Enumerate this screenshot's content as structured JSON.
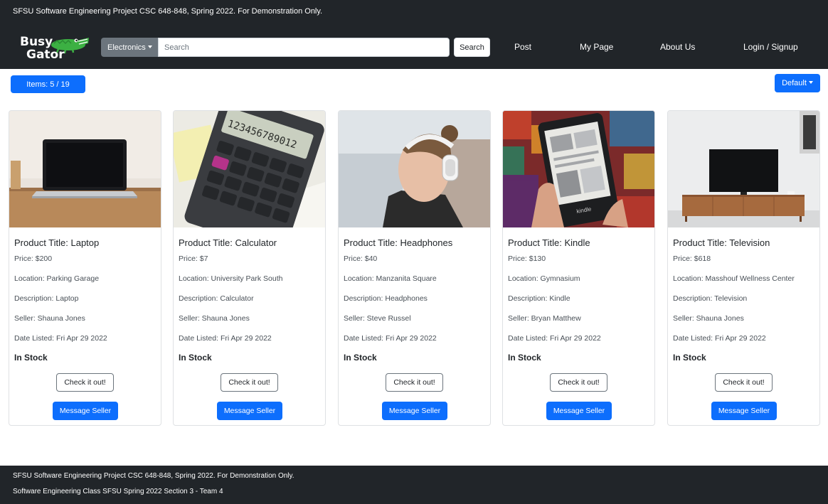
{
  "banner": {
    "text": "SFSU Software Engineering Project CSC 648-848, Spring 2022. For Demonstration Only."
  },
  "brand": {
    "line1": "Busy",
    "line2": "Gator"
  },
  "search": {
    "category": "Electronics",
    "placeholder": "Search",
    "button_label": "Search"
  },
  "nav": [
    "Post",
    "My Page",
    "About Us",
    "Login / Signup"
  ],
  "toolbar": {
    "items_label": "Items: 5 / 19",
    "sort_label": "Default"
  },
  "products": [
    {
      "title": "Product Title: Laptop",
      "price": "Price: $200",
      "location": "Location: Parking Garage",
      "description": "Description: Laptop",
      "seller": "Seller: Shauna Jones",
      "date": "Date Listed: Fri Apr 29 2022",
      "stock": "In Stock",
      "check": "Check it out!",
      "message": "Message Seller"
    },
    {
      "title": "Product Title: Calculator",
      "price": "Price: $7",
      "location": "Location: University Park South",
      "description": "Description: Calculator",
      "seller": "Seller: Shauna Jones",
      "date": "Date Listed: Fri Apr 29 2022",
      "stock": "In Stock",
      "check": "Check it out!",
      "message": "Message Seller",
      "image_text": "123456789012"
    },
    {
      "title": "Product Title: Headphones",
      "price": "Price: $40",
      "location": "Location: Manzanita Square",
      "description": "Description: Headphones",
      "seller": "Seller: Steve Russel",
      "date": "Date Listed: Fri Apr 29 2022",
      "stock": "In Stock",
      "check": "Check it out!",
      "message": "Message Seller"
    },
    {
      "title": "Product Title: Kindle",
      "price": "Price: $130",
      "location": "Location: Gymnasium",
      "description": "Description: Kindle",
      "seller": "Seller: Bryan Matthew",
      "date": "Date Listed: Fri Apr 29 2022",
      "stock": "In Stock",
      "check": "Check it out!",
      "message": "Message Seller",
      "image_text": "kindle"
    },
    {
      "title": "Product Title: Television",
      "price": "Price: $618",
      "location": "Location: Masshouf Wellness Center",
      "description": "Description: Television",
      "seller": "Seller: Shauna Jones",
      "date": "Date Listed: Fri Apr 29 2022",
      "stock": "In Stock",
      "check": "Check it out!",
      "message": "Message Seller"
    }
  ],
  "footer": {
    "line1": "SFSU Software Engineering Project CSC 648-848, Spring 2022. For Demonstration Only.",
    "line2": "Software Engineering Class SFSU Spring 2022 Section 3 - Team 4"
  },
  "colors": {
    "dark": "#212529",
    "primary": "#0d6efd",
    "secondary": "#6c757d",
    "gator_green": "#3cb043"
  }
}
